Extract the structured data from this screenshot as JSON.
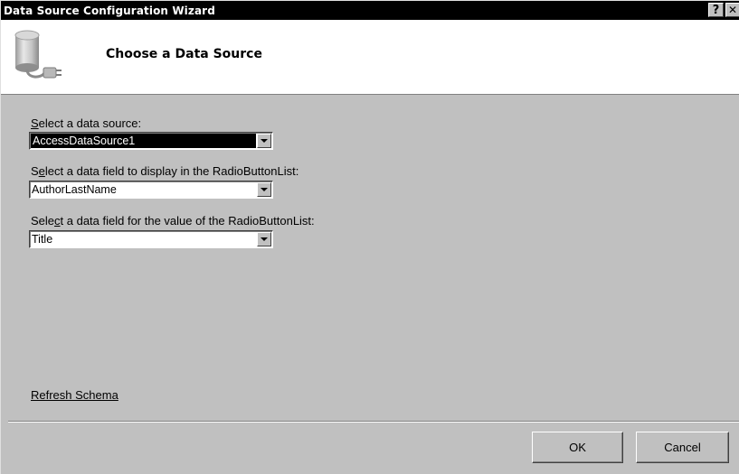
{
  "window": {
    "title": "Data Source Configuration Wizard",
    "help_glyph": "?",
    "close_glyph": "✕"
  },
  "header": {
    "heading": "Choose a Data Source",
    "icon": "database-connector-icon"
  },
  "fields": [
    {
      "label_pre": "",
      "label_key": "S",
      "label_post": "elect a data source:",
      "value": "AccessDataSource1",
      "selected": true
    },
    {
      "label_pre": "S",
      "label_key": "e",
      "label_post": "lect a data field to display in the RadioButtonList:",
      "value": "AuthorLastName",
      "selected": false
    },
    {
      "label_pre": "Sele",
      "label_key": "c",
      "label_post": "t a data field for the value of the RadioButtonList:",
      "value": "Title",
      "selected": false
    }
  ],
  "refresh_link": "Refresh Schema",
  "buttons": {
    "ok": "OK",
    "cancel": "Cancel"
  },
  "colors": {
    "title_bar": "#000000",
    "dialog_face": "#c0c0c0",
    "header_bg": "#ffffff",
    "selection": "#000000"
  }
}
